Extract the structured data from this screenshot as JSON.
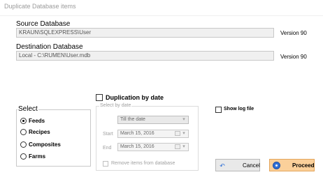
{
  "window": {
    "title": "Duplicate Database items"
  },
  "source": {
    "label": "Source Database",
    "path": "KRAUN\\SQLEXPRESS\\User",
    "version": "Version 90"
  },
  "destination": {
    "label": "Destination Database",
    "path": "Local - C:\\RUMEN\\User.mdb",
    "version": "Version 90"
  },
  "duplication": {
    "checkbox_label": "Duplication by date",
    "checked": false,
    "group_title": "Select by date",
    "mode_value": "Till the date",
    "start_label": "Start",
    "start_value": "March   15, 2016",
    "end_label": "End",
    "end_value": "March   15, 2016",
    "remove_label": "Remove items from database"
  },
  "select": {
    "title": "Select",
    "options": [
      {
        "label": "Feeds",
        "checked": true
      },
      {
        "label": "Recipes",
        "checked": false
      },
      {
        "label": "Composites",
        "checked": false
      },
      {
        "label": "Farms",
        "checked": false
      }
    ]
  },
  "log": {
    "label": "Show log file",
    "checked": false
  },
  "buttons": {
    "cancel": "Cancel",
    "proceed": "Proceed"
  },
  "icons": {
    "cancel": "undo-arrow-icon",
    "proceed": "proceed-disc-icon",
    "calendar": "calendar-icon",
    "dropdown": "chevron-down-icon"
  }
}
